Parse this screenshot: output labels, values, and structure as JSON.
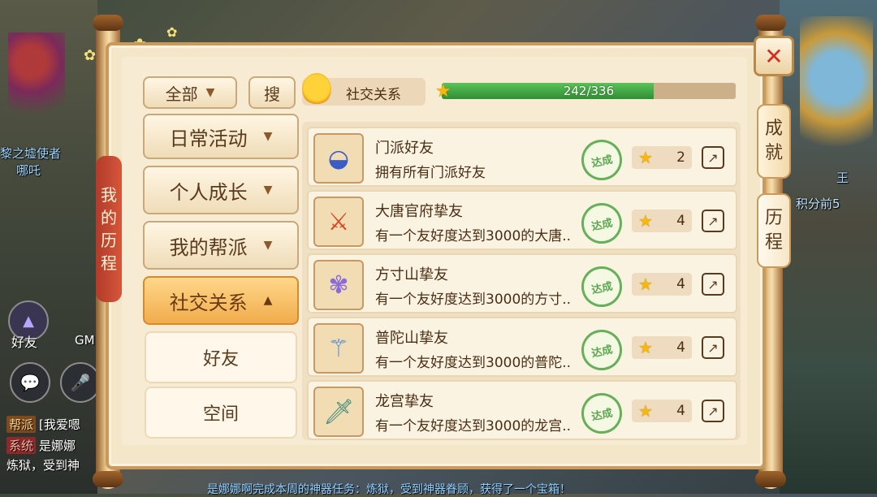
{
  "background": {
    "left_char_name_1": "黎之墟使者",
    "left_char_name_2": "哪吒",
    "right_char_name_1": "王",
    "right_char_name_2": "积分前5",
    "friend_label": "好友",
    "gm_label": "GM",
    "chat": [
      {
        "tag": "帮派",
        "text": "[我爱嗯"
      },
      {
        "tag": "系统",
        "text": "是娜娜"
      },
      {
        "tag": "",
        "text": "炼狱，受到神"
      }
    ],
    "bottom_ticker": "是娜娜啊完成本周的神器任务：炼狱，受到神器眷顾，获得了一个宝箱！"
  },
  "panel": {
    "vertical_title": [
      "我",
      "的",
      "历",
      "程"
    ],
    "close_icon": "close-icon",
    "filter_label": "全部",
    "search_label": "搜",
    "category_label": "社交关系",
    "progress": {
      "current": 242,
      "total": 336,
      "text": "242/336",
      "fraction": 0.72
    },
    "right_tabs": [
      {
        "label": [
          "成",
          "就"
        ]
      },
      {
        "label": [
          "历",
          "程"
        ]
      }
    ],
    "sidebar": [
      {
        "label": "日常活动",
        "state": "collapsed"
      },
      {
        "label": "个人成长",
        "state": "collapsed"
      },
      {
        "label": "我的帮派",
        "state": "collapsed"
      },
      {
        "label": "社交关系",
        "state": "expanded"
      }
    ],
    "subitems": [
      {
        "label": "好友"
      },
      {
        "label": "空间"
      }
    ],
    "achievements": [
      {
        "icon": "bowl-icon",
        "title": "门派好友",
        "desc": "拥有所有门派好友",
        "status": "达成",
        "points": "2"
      },
      {
        "icon": "sword-icon",
        "title": "大唐官府挚友",
        "desc": "有一个友好度达到3000的大唐..",
        "status": "达成",
        "points": "4"
      },
      {
        "icon": "flower-icon",
        "title": "方寸山挚友",
        "desc": "有一个友好度达到3000的方寸..",
        "status": "达成",
        "points": "4"
      },
      {
        "icon": "staff-icon",
        "title": "普陀山挚友",
        "desc": "有一个友好度达到3000的普陀..",
        "status": "达成",
        "points": "4"
      },
      {
        "icon": "blade-icon",
        "title": "龙宫挚友",
        "desc": "有一个友好度达到3000的龙宫..",
        "status": "达成",
        "points": "4"
      }
    ],
    "colors": {
      "progress_fill": "#3ea142",
      "progress_track": "#cbb08a",
      "accent": "#f1ac4d",
      "stamp": "#5da650"
    }
  }
}
